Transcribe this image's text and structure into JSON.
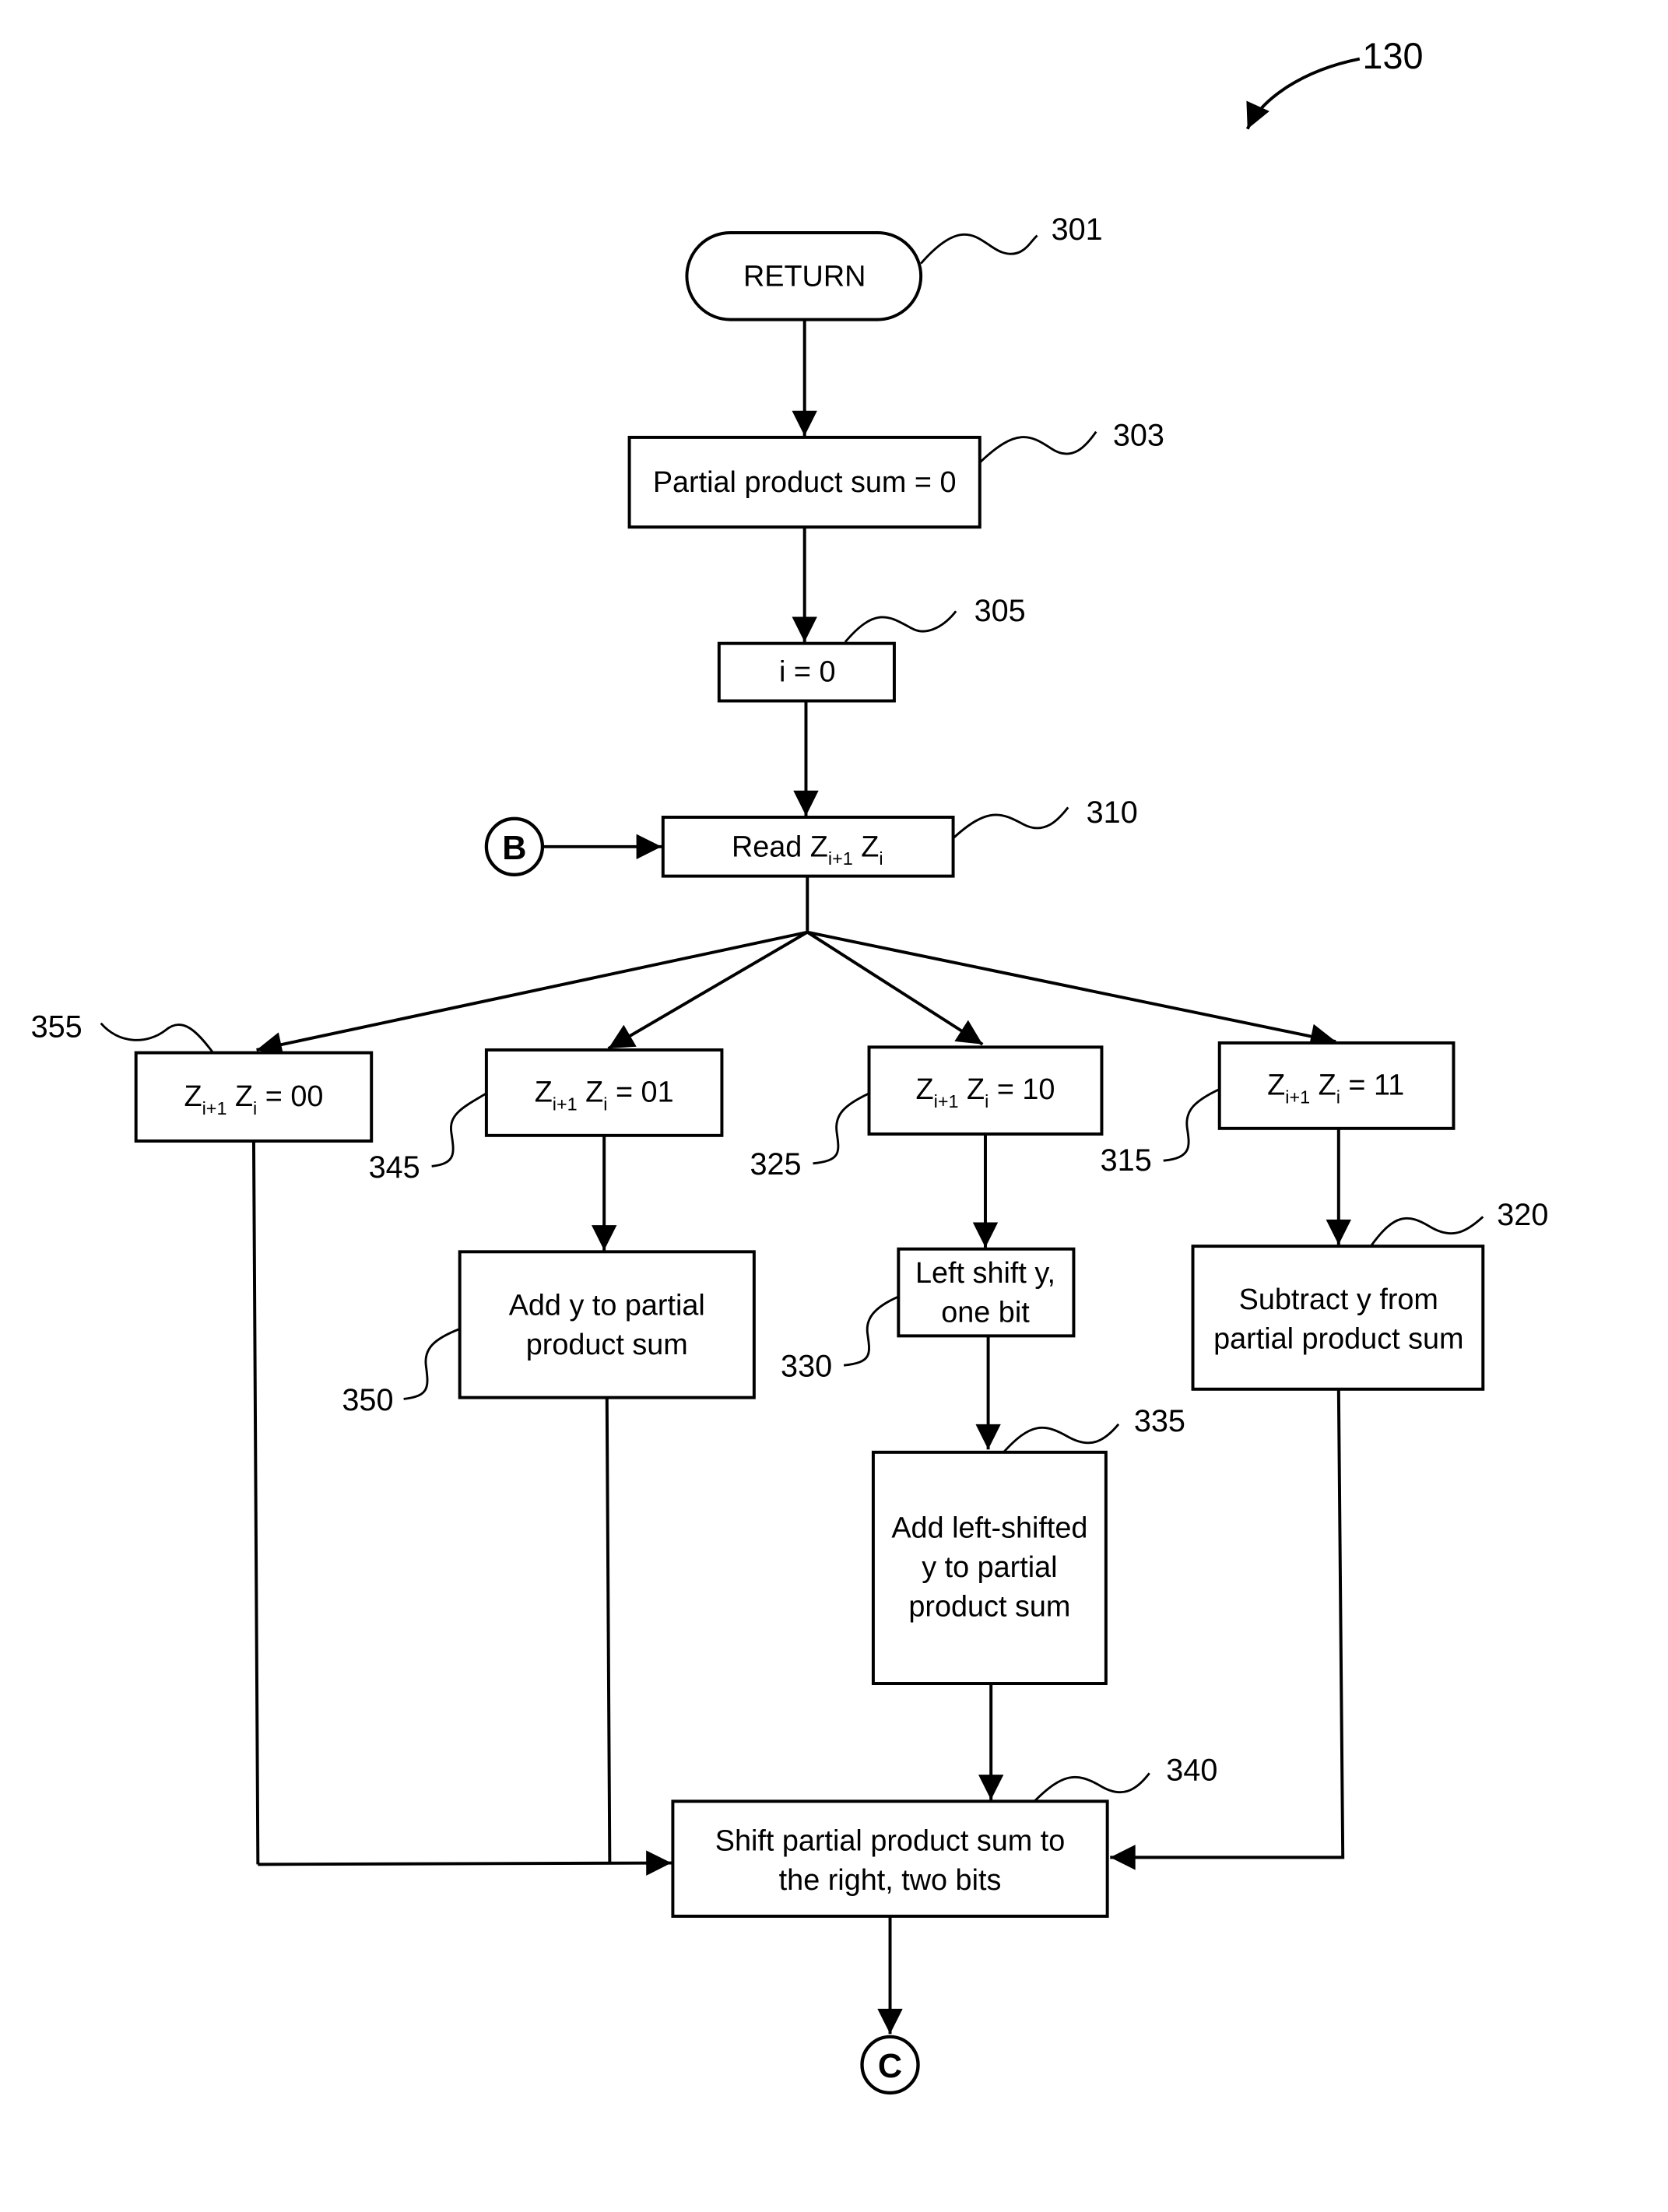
{
  "figure": {
    "reference": "130"
  },
  "nodes": {
    "n301": {
      "ref": "301",
      "label": "RETURN"
    },
    "n303": {
      "ref": "303",
      "label": "Partial product sum = 0"
    },
    "n305": {
      "ref": "305",
      "label": "i = 0"
    },
    "n310": {
      "ref": "310",
      "label_main": "Read Z",
      "sub1": "i+1",
      "mid": " Z",
      "sub2": "i"
    },
    "n355": {
      "ref": "355",
      "z": "Z",
      "sub1": "i+1",
      "mid": " Z",
      "sub2": "i",
      "tail": " = 00"
    },
    "n345": {
      "ref": "345",
      "z": "Z",
      "sub1": "i+1",
      "mid": " Z",
      "sub2": "i",
      "tail": " = 01"
    },
    "n325": {
      "ref": "325",
      "z": "Z",
      "sub1": "i+1",
      "mid": " Z",
      "sub2": "i",
      "tail": " = 10"
    },
    "n315": {
      "ref": "315",
      "z": "Z",
      "sub1": "i+1",
      "mid": " Z",
      "sub2": "i",
      "tail": " = 11"
    },
    "n350": {
      "ref": "350",
      "line1": "Add y to partial",
      "line2": "product sum"
    },
    "n330": {
      "ref": "330",
      "line1": "Left shift y,",
      "line2": "one bit"
    },
    "n335": {
      "ref": "335",
      "line1": "Add left-shifted",
      "line2": "y to partial",
      "line3": "product sum"
    },
    "n320": {
      "ref": "320",
      "line1": "Subtract y from",
      "line2": "partial product sum"
    },
    "n340": {
      "ref": "340",
      "line1": "Shift partial product sum to",
      "line2": "the right, two bits"
    }
  },
  "connectors": {
    "in": "B",
    "out": "C"
  }
}
